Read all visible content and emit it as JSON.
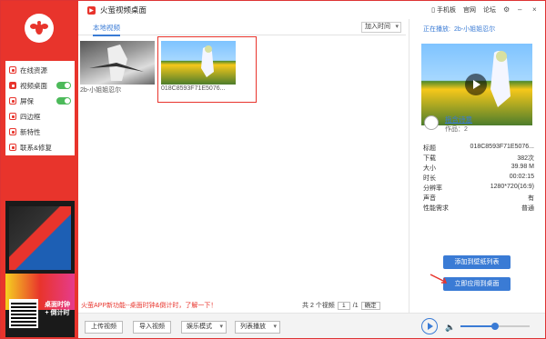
{
  "app": {
    "title": "火萤视频桌面",
    "top_links": [
      "手机板",
      "官网",
      "论坛"
    ]
  },
  "sidebar": {
    "items": [
      {
        "label": "在线资源",
        "toggle": false
      },
      {
        "label": "视频桌面",
        "toggle": true,
        "active": true
      },
      {
        "label": "屏保",
        "toggle": false
      },
      {
        "label": "四边框",
        "toggle": false
      },
      {
        "label": "新特性",
        "toggle": false
      },
      {
        "label": "联系&修复",
        "toggle": false
      }
    ],
    "promo_text": "桌面时钟 + 倒计时"
  },
  "center": {
    "tab": "本地视频",
    "sort": "加入时间",
    "videos": [
      {
        "caption": "2b-小姐姐忍尔"
      },
      {
        "caption": "018C8593F71E5076..."
      }
    ],
    "notice": "火萤APP新功能--桌面时钟&倒计时，了解一下！",
    "pager": {
      "total_text": "共 2 个视频",
      "page": "1",
      "pages": "/1",
      "go": "确定"
    }
  },
  "bottom": {
    "upload": "上传视频",
    "import": "导入视频",
    "mode": "娱乐模式",
    "play_mode": "列表播放",
    "volume": 0.5
  },
  "right": {
    "now_playing_label": "正在播放:",
    "now_playing": "2b-小姐姐忍尔",
    "author_name": "拖含诗意",
    "author_works": "作品：2",
    "info": [
      {
        "k": "标题",
        "v": "018C8593F71E5076..."
      },
      {
        "k": "下载",
        "v": "382次"
      },
      {
        "k": "大小",
        "v": "39.98 M"
      },
      {
        "k": "时长",
        "v": "00:02:15"
      },
      {
        "k": "分辨率",
        "v": "1280*720(16:9)"
      },
      {
        "k": "声音",
        "v": "有"
      },
      {
        "k": "性能需求",
        "v": "普通"
      }
    ],
    "add_to_list": "添加到壁纸列表",
    "apply_now": "立即应用到桌面"
  },
  "colors": {
    "brand": "#e8342c",
    "accent": "#3a7bd5"
  }
}
